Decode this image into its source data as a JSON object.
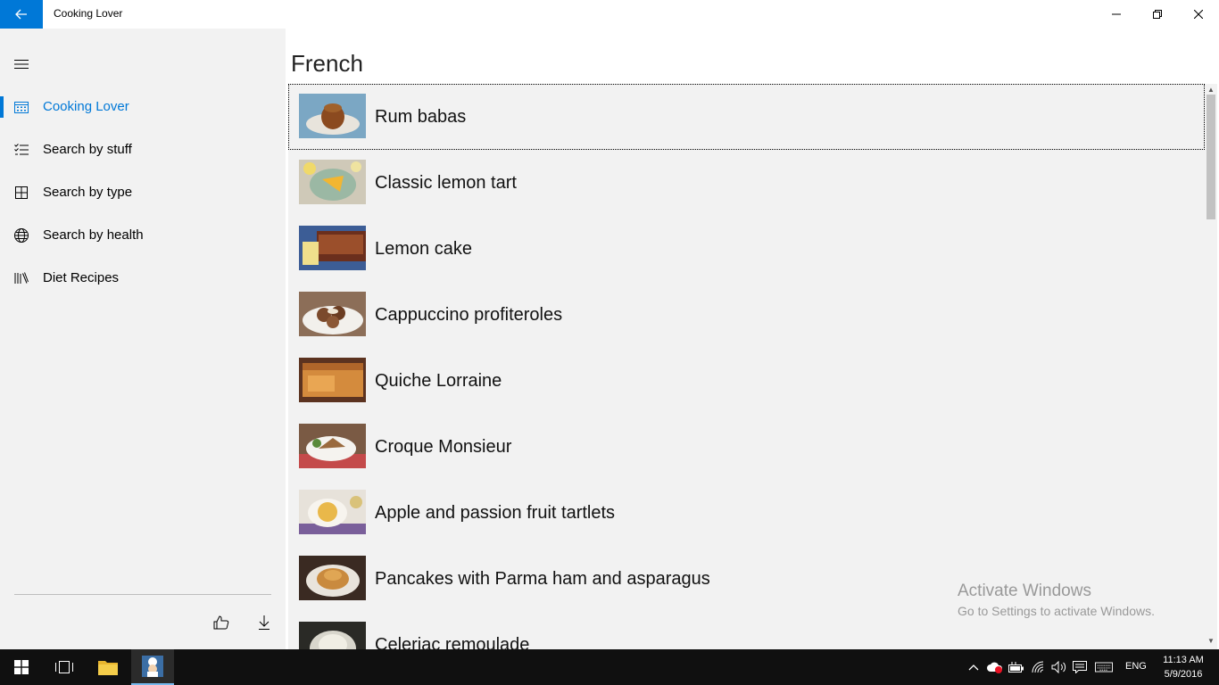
{
  "window": {
    "title": "Cooking Lover"
  },
  "sidebar": {
    "items": [
      {
        "label": "Cooking Lover",
        "icon": "calendar-icon",
        "active": true
      },
      {
        "label": "Search by stuff",
        "icon": "checklist-icon",
        "active": false
      },
      {
        "label": "Search by type",
        "icon": "grid-icon",
        "active": false
      },
      {
        "label": "Search by health",
        "icon": "globe-icon",
        "active": false
      },
      {
        "label": "Diet Recipes",
        "icon": "library-icon",
        "active": false
      }
    ],
    "footer": {
      "like_icon": "thumbs-up-icon",
      "download_icon": "download-icon"
    }
  },
  "main": {
    "page_title": "French",
    "recipes": [
      {
        "title": "Rum babas"
      },
      {
        "title": "Classic lemon tart"
      },
      {
        "title": "Lemon cake"
      },
      {
        "title": "Cappuccino profiteroles"
      },
      {
        "title": "Quiche Lorraine"
      },
      {
        "title": "Croque Monsieur"
      },
      {
        "title": "Apple and passion fruit tartlets"
      },
      {
        "title": "Pancakes with Parma ham and asparagus"
      },
      {
        "title": "Celeriac remoulade"
      }
    ]
  },
  "watermark": {
    "title": "Activate Windows",
    "subtitle": "Go to Settings to activate Windows."
  },
  "taskbar": {
    "language": "ENG",
    "time": "11:13 AM",
    "date": "5/9/2016"
  },
  "colors": {
    "accent": "#0078d7",
    "sidebar_bg": "#f2f2f2",
    "taskbar_bg": "#101010"
  }
}
